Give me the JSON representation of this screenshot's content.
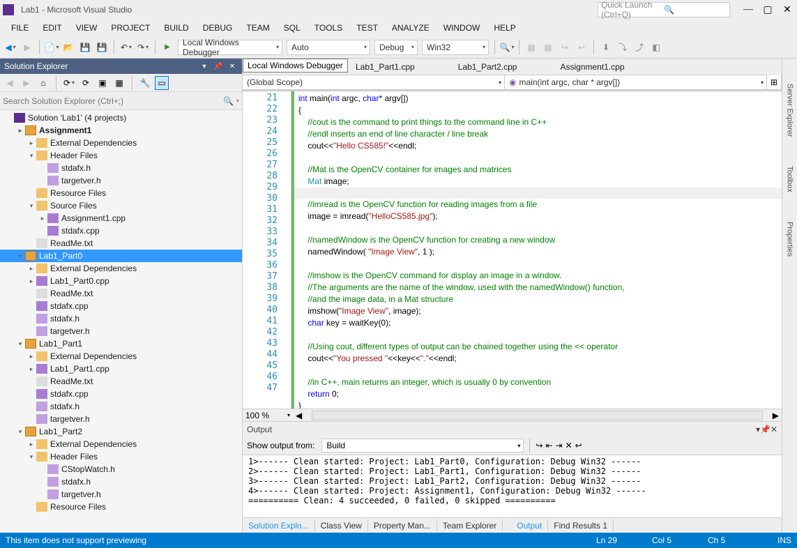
{
  "title": "Lab1 - Microsoft Visual Studio",
  "quick_launch_placeholder": "Quick Launch (Ctrl+Q)",
  "menu": [
    "FILE",
    "EDIT",
    "VIEW",
    "PROJECT",
    "BUILD",
    "DEBUG",
    "TEAM",
    "SQL",
    "TOOLS",
    "TEST",
    "ANALYZE",
    "WINDOW",
    "HELP"
  ],
  "debugger_label": "Local Windows Debugger",
  "tooltip_text": "Local Windows Debugger",
  "cfg_auto": "Auto",
  "cfg_debug": "Debug",
  "cfg_platform": "Win32",
  "sol_explorer": {
    "title": "Solution Explorer",
    "search_placeholder": "Search Solution Explorer (Ctrl+;)"
  },
  "tree": [
    {
      "d": 0,
      "a": "",
      "i": "sln",
      "t": "Solution 'Lab1' (4 projects)"
    },
    {
      "d": 1,
      "a": "▸",
      "i": "prj",
      "t": "Assignment1",
      "b": true
    },
    {
      "d": 2,
      "a": "▸",
      "i": "fldr",
      "t": "External Dependencies"
    },
    {
      "d": 2,
      "a": "▾",
      "i": "fldr",
      "t": "Header Files"
    },
    {
      "d": 3,
      "a": "",
      "i": "h",
      "t": "stdafx.h"
    },
    {
      "d": 3,
      "a": "",
      "i": "h",
      "t": "targetver.h"
    },
    {
      "d": 2,
      "a": "",
      "i": "fldr",
      "t": "Resource Files"
    },
    {
      "d": 2,
      "a": "▾",
      "i": "fldr",
      "t": "Source Files"
    },
    {
      "d": 3,
      "a": "▸",
      "i": "cpp",
      "t": "Assignment1.cpp"
    },
    {
      "d": 3,
      "a": "",
      "i": "cpp",
      "t": "stdafx.cpp"
    },
    {
      "d": 2,
      "a": "",
      "i": "txt",
      "t": "ReadMe.txt"
    },
    {
      "d": 1,
      "a": "▾",
      "i": "prj",
      "t": "Lab1_Part0",
      "sel": true
    },
    {
      "d": 2,
      "a": "▸",
      "i": "fldr",
      "t": "External Dependencies"
    },
    {
      "d": 2,
      "a": "▸",
      "i": "cpp",
      "t": "Lab1_Part0.cpp"
    },
    {
      "d": 2,
      "a": "",
      "i": "txt",
      "t": "ReadMe.txt"
    },
    {
      "d": 2,
      "a": "",
      "i": "cpp",
      "t": "stdafx.cpp"
    },
    {
      "d": 2,
      "a": "",
      "i": "h",
      "t": "stdafx.h"
    },
    {
      "d": 2,
      "a": "",
      "i": "h",
      "t": "targetver.h"
    },
    {
      "d": 1,
      "a": "▾",
      "i": "prj",
      "t": "Lab1_Part1"
    },
    {
      "d": 2,
      "a": "▸",
      "i": "fldr",
      "t": "External Dependencies"
    },
    {
      "d": 2,
      "a": "▸",
      "i": "cpp",
      "t": "Lab1_Part1.cpp"
    },
    {
      "d": 2,
      "a": "",
      "i": "txt",
      "t": "ReadMe.txt"
    },
    {
      "d": 2,
      "a": "",
      "i": "cpp",
      "t": "stdafx.cpp"
    },
    {
      "d": 2,
      "a": "",
      "i": "h",
      "t": "stdafx.h"
    },
    {
      "d": 2,
      "a": "",
      "i": "h",
      "t": "targetver.h"
    },
    {
      "d": 1,
      "a": "▾",
      "i": "prj",
      "t": "Lab1_Part2"
    },
    {
      "d": 2,
      "a": "▸",
      "i": "fldr",
      "t": "External Dependencies"
    },
    {
      "d": 2,
      "a": "▾",
      "i": "fldr",
      "t": "Header Files"
    },
    {
      "d": 3,
      "a": "",
      "i": "h",
      "t": "CStopWatch.h"
    },
    {
      "d": 3,
      "a": "",
      "i": "h",
      "t": "stdafx.h"
    },
    {
      "d": 3,
      "a": "",
      "i": "h",
      "t": "targetver.h"
    },
    {
      "d": 2,
      "a": "",
      "i": "fldr",
      "t": "Resource Files"
    }
  ],
  "editor_tabs": [
    "Lab1_Part1.cpp",
    "Lab1_Part2.cpp",
    "Assignment1.cpp"
  ],
  "nav_scope": "(Global Scope)",
  "nav_func": "main(int argc, char * argv[])",
  "line_start": 21,
  "line_end": 47,
  "code_lines": [
    {
      "html": "<span class='kw'>int</span> <span class='nm'>main</span>(<span class='kw'>int</span> <span class='nm'>argc</span>, <span class='kw'>char</span>* <span class='nm'>argv</span>[])"
    },
    {
      "html": "{"
    },
    {
      "html": "    <span class='cm'>//cout is the command to print things to the command line in C++</span>"
    },
    {
      "html": "    <span class='cm'>//endl inserts an end of line character / line break</span>"
    },
    {
      "html": "    <span class='nm'>cout</span>&lt;&lt;<span class='st'>\"Hello CS585!\"</span>&lt;&lt;<span class='nm'>endl</span>;"
    },
    {
      "html": ""
    },
    {
      "html": "    <span class='cm'>//Mat is the OpenCV container for images and matrices</span>"
    },
    {
      "html": "    <span class='ty'>Mat</span> <span class='nm'>image</span>;"
    },
    {
      "html": "",
      "hl": true
    },
    {
      "html": "    <span class='cm'>//imread is the OpenCV function for reading images from a file</span>"
    },
    {
      "html": "    <span class='nm'>image</span> = <span class='nm'>imread</span>(<span class='st'>\"HelloCS585.jpg\"</span>);"
    },
    {
      "html": ""
    },
    {
      "html": "    <span class='cm'>//namedWindow is the OpenCV function for creating a new window</span>"
    },
    {
      "html": "    <span class='nm'>namedWindow</span>( <span class='st'>\"Image View\"</span>, 1 );"
    },
    {
      "html": ""
    },
    {
      "html": "    <span class='cm'>//imshow is the OpenCV command for display an image in a window.</span>"
    },
    {
      "html": "    <span class='cm'>//The arguments are the name of the window, used with the namedWindow() function,</span>"
    },
    {
      "html": "    <span class='cm'>//and the image data, in a Mat structure</span>"
    },
    {
      "html": "    <span class='nm'>imshow</span>(<span class='st'>\"Image View\"</span>, <span class='nm'>image</span>);"
    },
    {
      "html": "    <span class='kw'>char</span> <span class='nm'>key</span> = <span class='nm'>waitKey</span>(0);"
    },
    {
      "html": ""
    },
    {
      "html": "    <span class='cm'>//Using cout, different types of output can be chained together using the &lt;&lt; operator</span>"
    },
    {
      "html": "    <span class='nm'>cout</span>&lt;&lt;<span class='st'>\"You pressed \"</span>&lt;&lt;<span class='nm'>key</span>&lt;&lt;<span class='st'>\".\"</span>&lt;&lt;<span class='nm'>endl</span>;"
    },
    {
      "html": ""
    },
    {
      "html": "    <span class='cm'>//in C++, main returns an integer, which is usually 0 by convention</span>"
    },
    {
      "html": "    <span class='kw'>return</span> 0;"
    },
    {
      "html": "}"
    }
  ],
  "zoom": "100 %",
  "output": {
    "title": "Output",
    "from_label": "Show output from:",
    "from_value": "Build",
    "lines": [
      "1>------ Clean started: Project: Lab1_Part0, Configuration: Debug Win32 ------",
      "2>------ Clean started: Project: Lab1_Part1, Configuration: Debug Win32 ------",
      "3>------ Clean started: Project: Lab1_Part2, Configuration: Debug Win32 ------",
      "4>------ Clean started: Project: Assignment1, Configuration: Debug Win32 ------",
      "========== Clean: 4 succeeded, 0 failed, 0 skipped =========="
    ]
  },
  "bottom_tabs_left": [
    "Solution Explo...",
    "Class View",
    "Property Man...",
    "Team Explorer"
  ],
  "bottom_tabs_right": [
    "Output",
    "Find Results 1"
  ],
  "right_rail": [
    "Server Explorer",
    "Toolbox",
    "Properties"
  ],
  "status": {
    "msg": "This item does not support previewing",
    "ln": "Ln 29",
    "col": "Col 5",
    "ch": "Ch 5",
    "ins": "INS"
  }
}
